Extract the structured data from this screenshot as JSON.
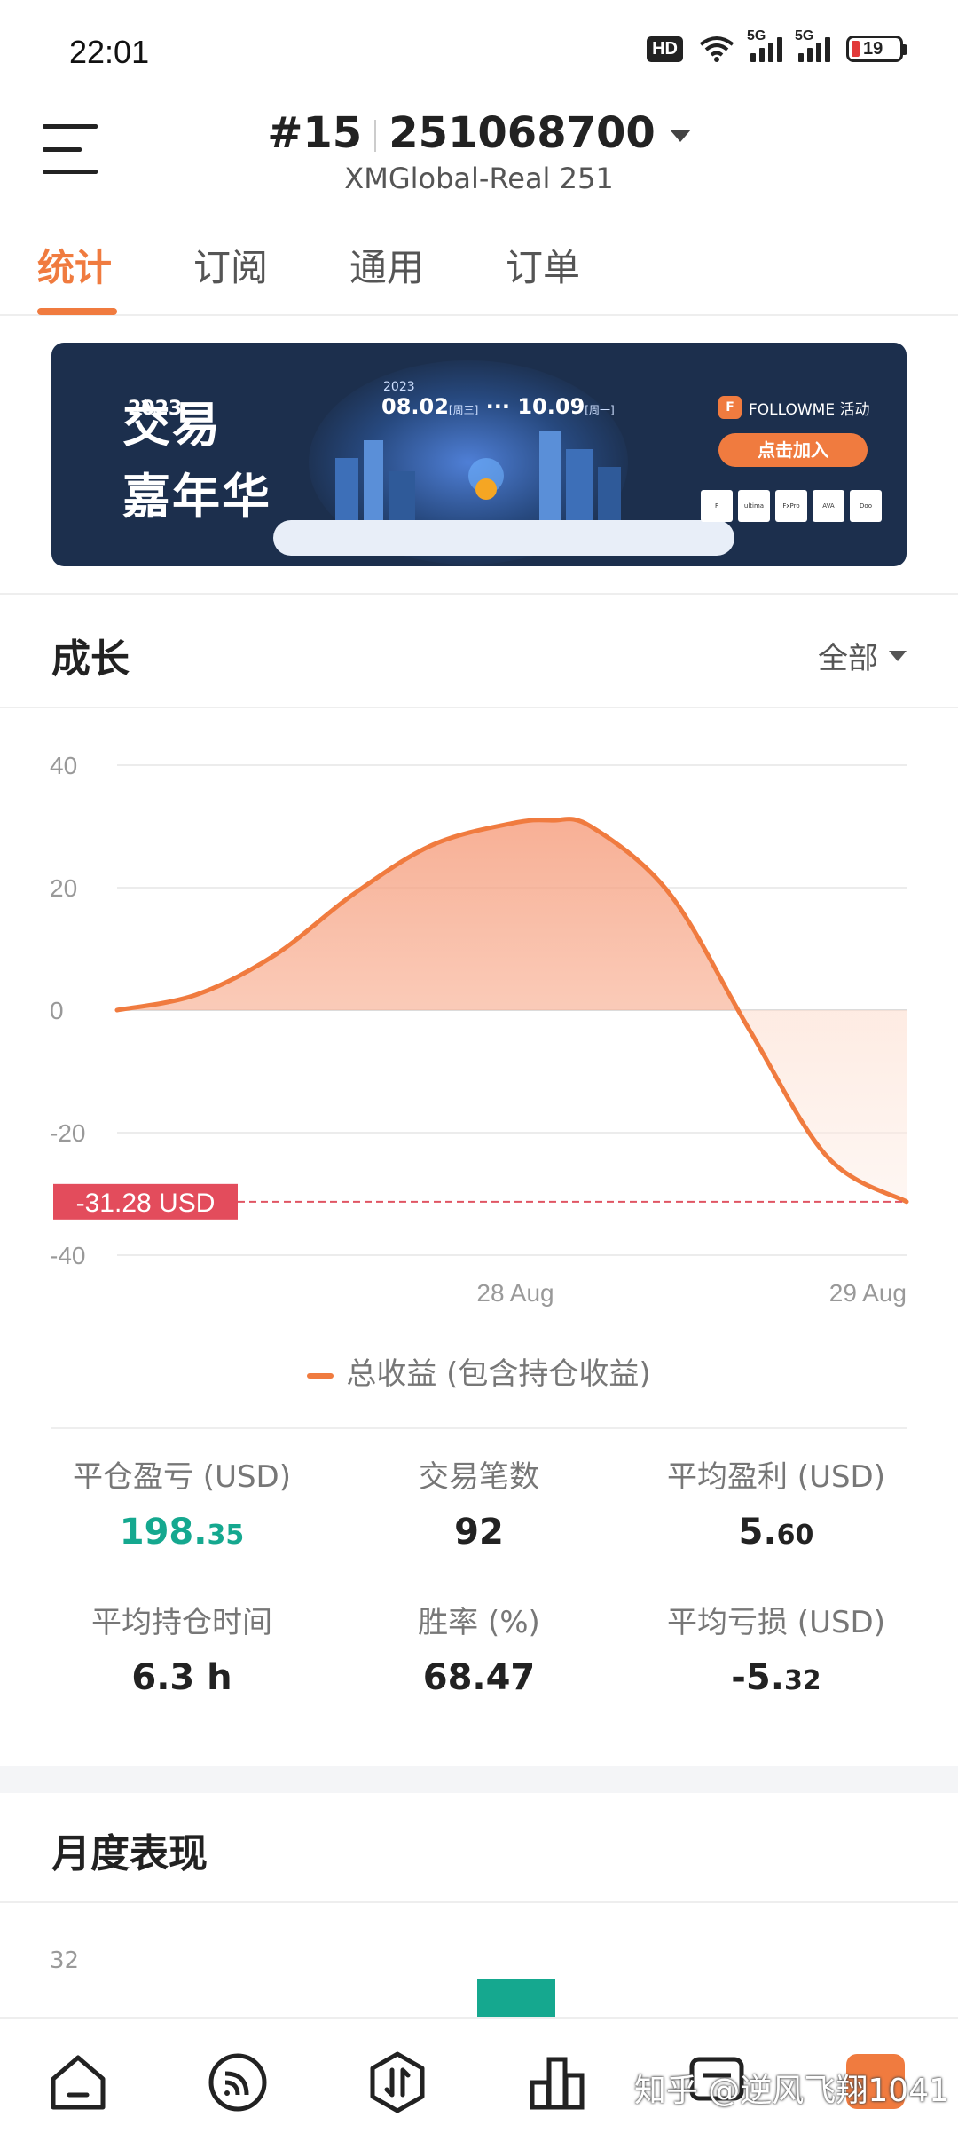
{
  "status_bar": {
    "time": "22:01",
    "hd": "HD",
    "net1": "5G",
    "net2": "5G",
    "battery": "19",
    "icons": [
      "hd-icon",
      "wifi-icon",
      "signal-icon",
      "signal-icon",
      "battery-icon"
    ]
  },
  "header": {
    "rank": "#15",
    "account_no": "251068700",
    "server": "XMGlobal-Real 251"
  },
  "tabs": [
    "统计",
    "订阅",
    "通用",
    "订单"
  ],
  "banner": {
    "year_text": "2023",
    "title_line1": "交易",
    "title_line2": "嘉年华",
    "date_year": "2023",
    "date_start": "08.02",
    "date_start_day": "[周三]",
    "date_end": "10.09",
    "date_end_day": "[周一]",
    "brand": "FOLLOWME 活动",
    "cta": "点击加入",
    "partners": [
      "F",
      "ultima",
      "FxPro",
      "AVA",
      "Doo Prime"
    ]
  },
  "growth": {
    "title": "成长",
    "filter": "全部"
  },
  "chart_data": {
    "type": "area",
    "y_ticks": [
      "40",
      "20",
      "0",
      "-20",
      "-40"
    ],
    "x_ticks": [
      "28 Aug",
      "29 Aug"
    ],
    "ylim": [
      -40,
      40
    ],
    "x": [
      0,
      0.1,
      0.2,
      0.3,
      0.4,
      0.5,
      0.55,
      0.6,
      0.7,
      0.8,
      0.9,
      1.0
    ],
    "series": [
      {
        "name": "总收益 (包含持仓收益)",
        "values": [
          0,
          2.5,
          9,
          19,
          27,
          30.5,
          31,
          30,
          19,
          -3,
          -24,
          -31.28
        ]
      }
    ],
    "marker_label": "-31.28 USD",
    "marker_value": -31.28,
    "color": "#f07b3f"
  },
  "legend": "总收益 (包含持仓收益)",
  "stats": {
    "closed_pl_label": "平仓盈亏 (USD)",
    "closed_pl_int": "198.",
    "closed_pl_dec": "35",
    "trades_label": "交易笔数",
    "trades": "92",
    "avg_profit_label": "平均盈利 (USD)",
    "avg_profit_int": "5.",
    "avg_profit_dec": "60",
    "avg_hold_label": "平均持仓时间",
    "avg_hold": "6.3 h",
    "win_rate_label": "胜率 (%)",
    "win_rate": "68.47",
    "avg_loss_label": "平均亏损 (USD)",
    "avg_loss_int": "-5.",
    "avg_loss_dec": "32"
  },
  "monthly": {
    "title": "月度表现",
    "tick": "32"
  },
  "bottom_nav": {
    "icons": [
      "home-icon",
      "subscribe-icon",
      "trade-icon",
      "ranking-icon",
      "message-icon",
      "hot-icon"
    ],
    "watermark": "知乎 @逆风飞翔1041"
  }
}
